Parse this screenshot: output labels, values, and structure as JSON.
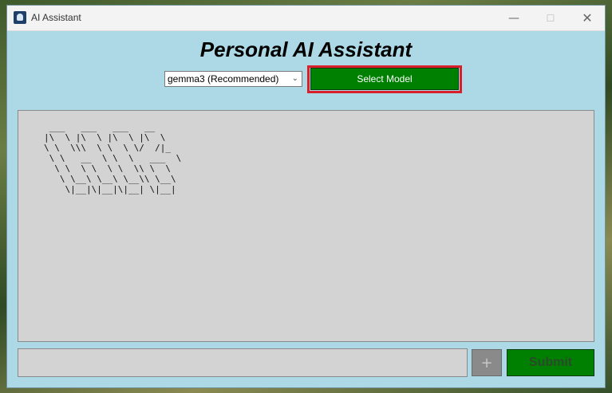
{
  "window": {
    "title": "AI Assistant",
    "controls": {
      "minimize": "—",
      "maximize": "☐",
      "close": "✕"
    }
  },
  "header": {
    "title": "Personal AI Assistant"
  },
  "model_picker": {
    "selected": "gemma3 (Recommended)",
    "select_button_label": "Select Model"
  },
  "output": {
    "ascii_art": " ___   ___   ___   __\n|\\  \\ |\\  \\ |\\  \\ |\\  \\\n\\ \\  \\\\\\  \\ \\  \\ \\/  /|_\n \\ \\   __  \\ \\  \\   ___  \\\n  \\ \\  \\ \\  \\ \\  \\\\ \\  \\\n   \\ \\__\\ \\__\\ \\__\\\\ \\__\\\n    \\|__|\\|__|\\|__| \\|__|"
  },
  "input_bar": {
    "prompt_value": "",
    "attach_label": "+",
    "submit_label": "Submit"
  },
  "colors": {
    "window_bg": "#add8e6",
    "button_green": "#008000",
    "panel_gray": "#d3d3d3",
    "highlight_red": "#d9202a"
  }
}
